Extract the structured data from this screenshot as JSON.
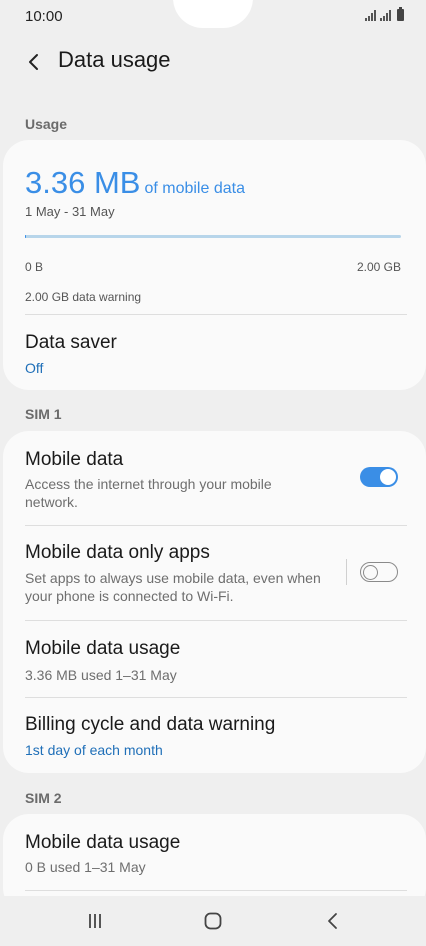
{
  "status_bar": {
    "time": "10:00"
  },
  "header": {
    "title": "Data usage",
    "back_icon": "chevron-left-icon"
  },
  "sections": {
    "usage": "Usage",
    "sim1": "SIM 1",
    "sim2": "SIM 2"
  },
  "usage": {
    "amount": "3.36 MB",
    "amount_suffix": "of mobile data",
    "period": "1 May - 31 May",
    "progress_fraction": 0.002,
    "min_label": "0 B",
    "max_label": "2.00 GB",
    "warning": "2.00 GB data warning",
    "accent_color": "#3a8ee6"
  },
  "data_saver": {
    "title": "Data saver",
    "value": "Off"
  },
  "sim1": {
    "mobile_data": {
      "title": "Mobile data",
      "subtitle": "Access the internet through your mobile network.",
      "enabled": true
    },
    "data_only_apps": {
      "title": "Mobile data only apps",
      "subtitle": "Set apps to always use mobile data, even when your phone is connected to Wi-Fi.",
      "enabled": false
    },
    "usage": {
      "title": "Mobile data usage",
      "subtitle": "3.36 MB used 1–31 May"
    },
    "billing": {
      "title": "Billing cycle and data warning",
      "value": "1st day of each month"
    }
  },
  "sim2": {
    "usage": {
      "title": "Mobile data usage",
      "subtitle": "0 B used 1–31 May"
    }
  },
  "nav": {
    "recents_icon": "recents-icon",
    "home_icon": "home-icon",
    "back_icon": "back-icon"
  }
}
